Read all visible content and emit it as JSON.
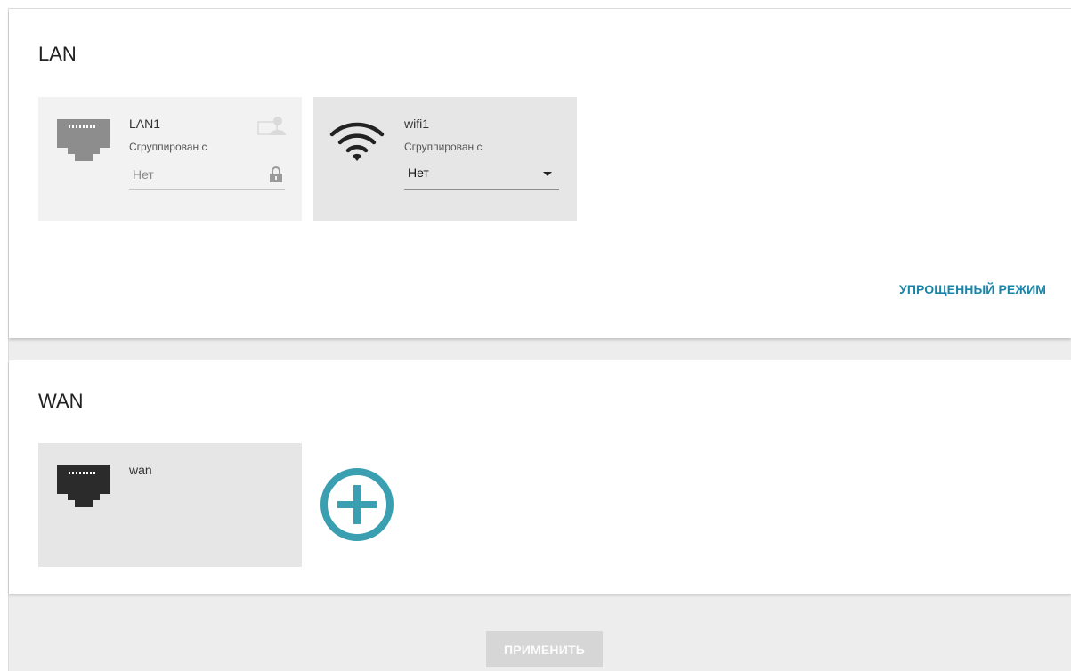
{
  "lan": {
    "title": "LAN",
    "cards": [
      {
        "name": "LAN1",
        "grouped_label": "Сгруппирован с",
        "grouped_value": "Нет",
        "icon": "ethernet-port-icon",
        "locked": true
      },
      {
        "name": "wifi1",
        "grouped_label": "Сгруппирован с",
        "grouped_value": "Нет",
        "icon": "wifi-icon"
      }
    ],
    "simple_mode_link": "УПРОЩЕННЫЙ РЕЖИМ"
  },
  "wan": {
    "title": "WAN",
    "cards": [
      {
        "name": "wan",
        "icon": "ethernet-port-icon"
      }
    ],
    "add_icon": "plus-circle-icon"
  },
  "footer": {
    "apply_label": "ПРИМЕНИТЬ"
  },
  "colors": {
    "accent": "#1784a8",
    "add_button": "#3a9fb0",
    "card_bg": "#f2f2f2",
    "card_bg_dark": "#e6e6e6",
    "button_disabled": "#d6d6d6"
  }
}
